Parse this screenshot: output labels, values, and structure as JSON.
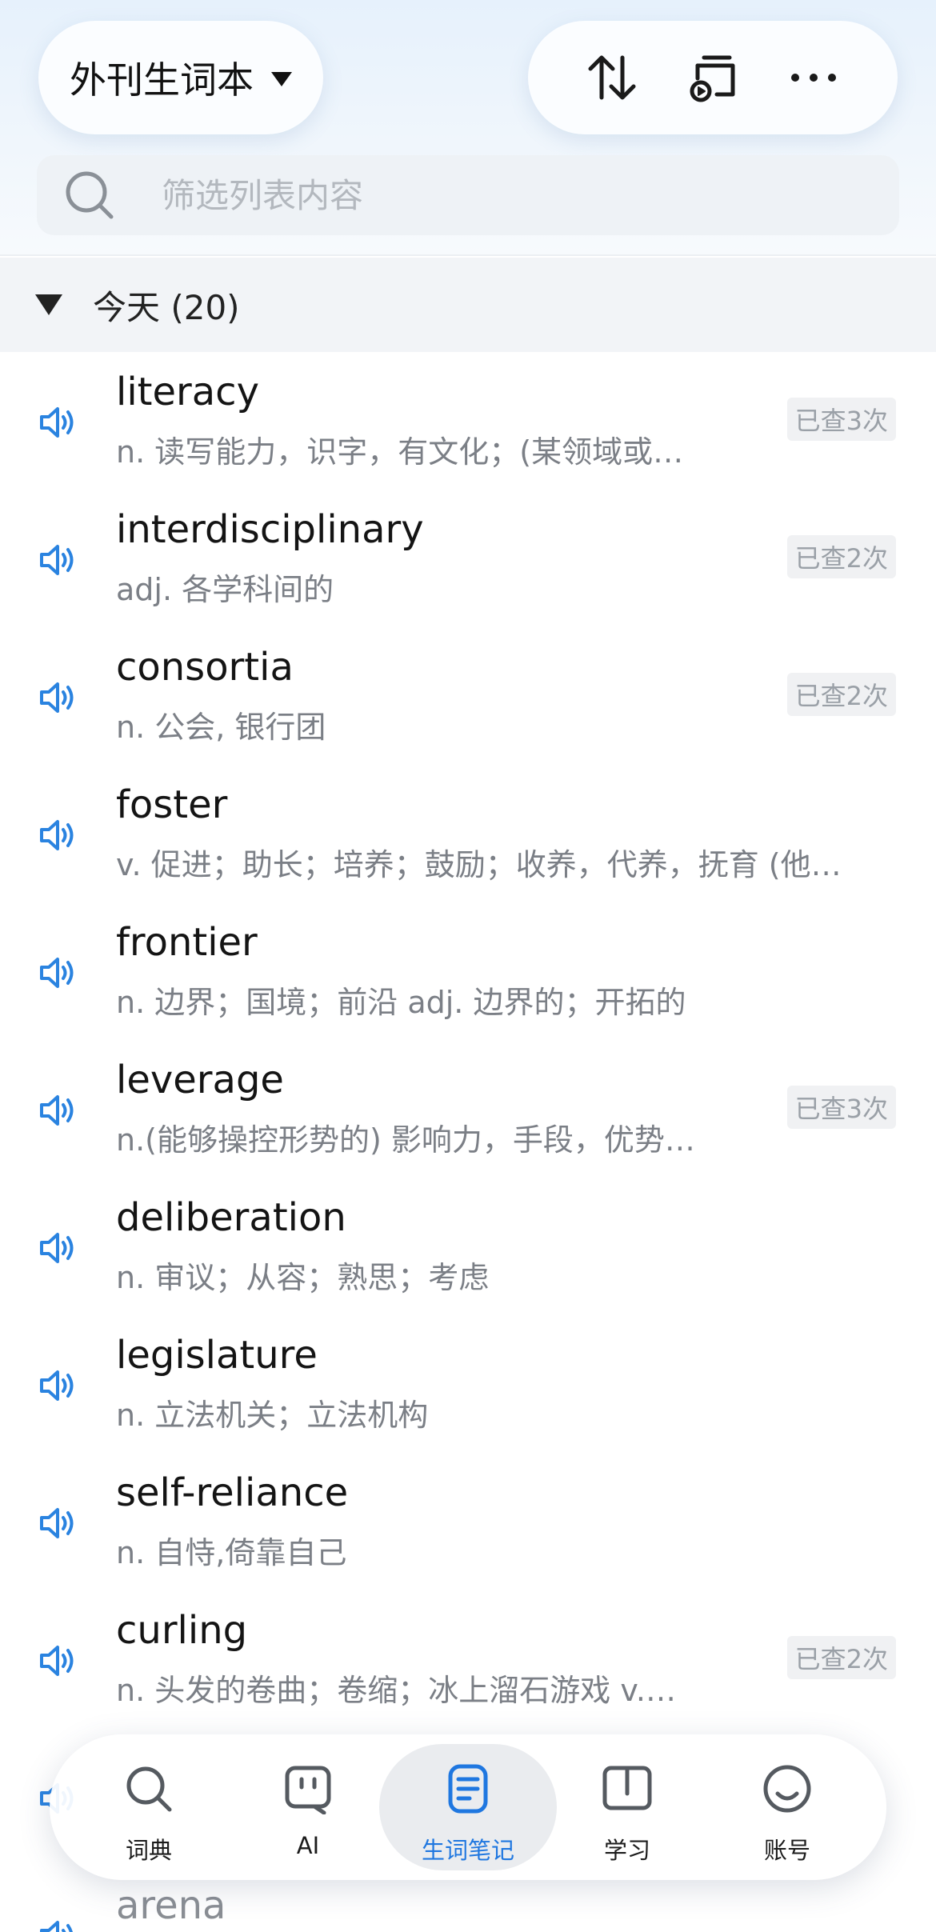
{
  "header": {
    "book_title": "外刊生词本",
    "search_placeholder": "筛选列表内容"
  },
  "group": {
    "label": "今天 (20)"
  },
  "words": [
    {
      "word": "literacy",
      "def": "n. 读写能力，识字，有文化；(某领域或…",
      "badge": "已查3次"
    },
    {
      "word": "interdisciplinary",
      "def": "adj. 各学科间的",
      "badge": "已查2次"
    },
    {
      "word": "consortia",
      "def": "n. 公会, 银行团",
      "badge": "已查2次"
    },
    {
      "word": "foster",
      "def": "v. 促进；助长；培养；鼓励；收养，代养，抚育 (他…",
      "badge": ""
    },
    {
      "word": "frontier",
      "def": "n. 边界；国境；前沿 adj. 边界的；开拓的",
      "badge": ""
    },
    {
      "word": "leverage",
      "def": "n.(能够操控形势的) 影响力，手段，优势…",
      "badge": "已查3次"
    },
    {
      "word": "deliberation",
      "def": "n. 审议；从容；熟思；考虑",
      "badge": ""
    },
    {
      "word": "legislature",
      "def": "n. 立法机关；立法机构",
      "badge": ""
    },
    {
      "word": "self-reliance",
      "def": "n. 自恃,倚靠自己",
      "badge": ""
    },
    {
      "word": "curling",
      "def": "n. 头发的卷曲；卷缩；冰上溜石游戏 v.…",
      "badge": "已查2次"
    },
    {
      "word": "",
      "def": "",
      "badge": ""
    },
    {
      "word": "arena",
      "def": "",
      "badge": ""
    }
  ],
  "nav": {
    "active": "生词笔记",
    "items": [
      {
        "label": "词典",
        "icon": "search-icon"
      },
      {
        "label": "AI",
        "icon": "ai-robot-icon"
      },
      {
        "label": "生词笔记",
        "icon": "notebook-icon"
      },
      {
        "label": "学习",
        "icon": "open-book-icon"
      },
      {
        "label": "账号",
        "icon": "smiley-icon"
      }
    ]
  },
  "colors": {
    "accent": "#1f77e0",
    "speaker": "#2a83e0",
    "definition": "#7b7f86",
    "badge_bg": "#f0f1f3"
  }
}
